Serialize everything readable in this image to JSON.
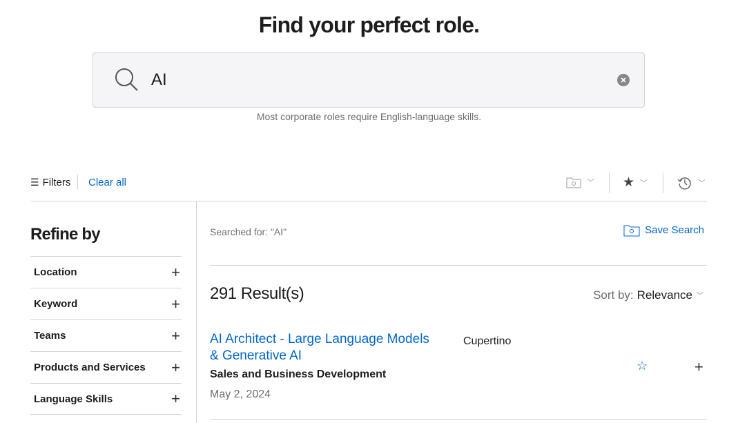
{
  "header": {
    "title": "Find your perfect role."
  },
  "search": {
    "value": "AI",
    "hint": "Most corporate roles require English-language skills.",
    "icon": "search-icon",
    "clear_icon": "clear-icon"
  },
  "toolbar": {
    "filters": "Filters",
    "clear_all": "Clear all",
    "icons": [
      "saved-search-folder-icon",
      "star-icon",
      "history-icon"
    ]
  },
  "sidebar": {
    "title": "Refine by",
    "items": [
      {
        "label": "Location"
      },
      {
        "label": "Keyword"
      },
      {
        "label": "Teams"
      },
      {
        "label": "Products and Services"
      },
      {
        "label": "Language Skills"
      }
    ]
  },
  "main": {
    "searched_for": "Searched for: \"AI\"",
    "save_search": "Save Search",
    "results": "291 Result(s)",
    "sort_label": "Sort by:",
    "sort_value": "Relevance",
    "jobs": [
      {
        "title": "AI Architect - Large Language Models & Generative AI",
        "team": "Sales and Business Development",
        "date": "May 2, 2024",
        "location": "Cupertino"
      }
    ]
  },
  "colors": {
    "accent": "#0066cc",
    "text": "#1d1d1f",
    "muted": "#6e6e73",
    "border": "#d2d2d7"
  }
}
